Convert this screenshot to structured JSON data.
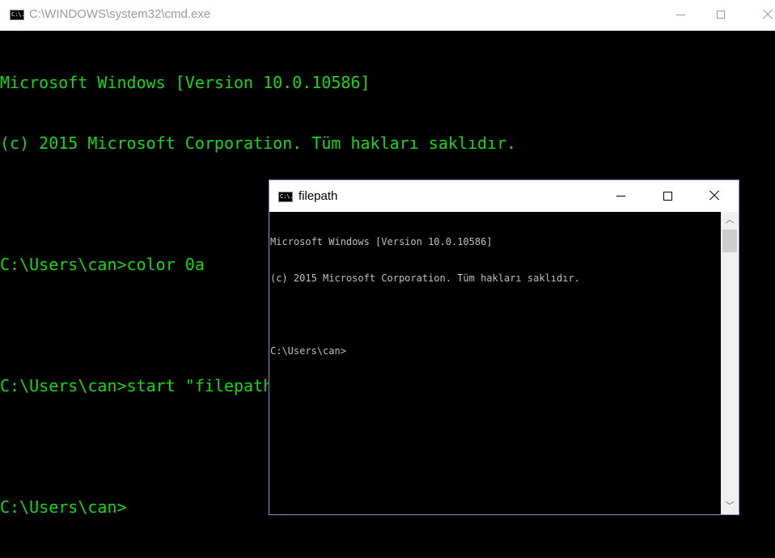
{
  "main_window": {
    "title": "C:\\WINDOWS\\system32\\cmd.exe",
    "icon_text": "C:\\.",
    "controls": {
      "minimize": "minimize",
      "maximize": "maximize",
      "close": "close"
    },
    "console_lines": [
      "Microsoft Windows [Version 10.0.10586]",
      "(c) 2015 Microsoft Corporation. Tüm hakları saklıdır.",
      "",
      "C:\\Users\\can>color 0a",
      "",
      "C:\\Users\\can>start \"filepath\"",
      "",
      "C:\\Users\\can>"
    ],
    "text_color": "#13d913",
    "background_color": "#000000"
  },
  "child_window": {
    "title": "filepath",
    "icon_text": "C:\\.",
    "console_lines": [
      "Microsoft Windows [Version 10.0.10586]",
      "(c) 2015 Microsoft Corporation. Tüm hakları saklıdır.",
      "",
      "C:\\Users\\can>"
    ],
    "text_color": "#c0c0c0",
    "background_color": "#000000",
    "scrollbar": {
      "up_arrow": "︿",
      "down_arrow": "﹀"
    }
  }
}
